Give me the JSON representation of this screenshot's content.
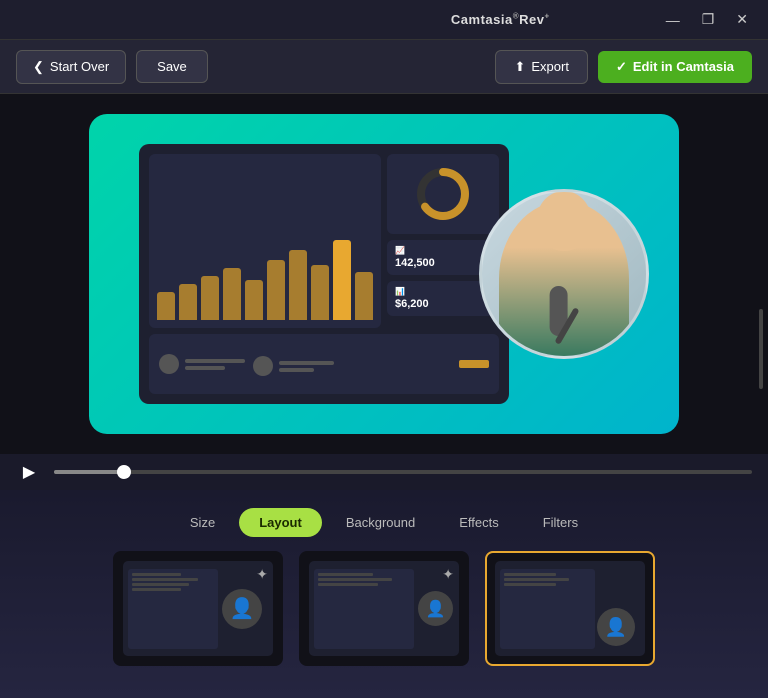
{
  "titleBar": {
    "title": "Camtasia",
    "titleSuffix": "®Rev",
    "titleSuperscript": "+",
    "minBtn": "—",
    "maxBtn": "❐",
    "closeBtn": "✕"
  },
  "toolbar": {
    "startOverLabel": "Start Over",
    "saveLabel": "Save",
    "exportLabel": "Export",
    "editInCamtasiaLabel": "Edit in Camtasia",
    "checkIcon": "✓",
    "uploadIcon": "⬆",
    "chevronLeft": "❮"
  },
  "preview": {
    "stats": {
      "stat1Label": "142,500",
      "stat2Label": "$6,200"
    }
  },
  "timeline": {
    "progressPercent": 10
  },
  "bottomPanel": {
    "tabs": [
      {
        "id": "size",
        "label": "Size",
        "active": false
      },
      {
        "id": "layout",
        "label": "Layout",
        "active": true
      },
      {
        "id": "background",
        "label": "Background",
        "active": false
      },
      {
        "id": "effects",
        "label": "Effects",
        "active": false
      },
      {
        "id": "filters",
        "label": "Filters",
        "active": false
      }
    ],
    "layouts": [
      {
        "id": "layout1",
        "selected": false,
        "sparkle": true
      },
      {
        "id": "layout2",
        "selected": false,
        "sparkle": true
      },
      {
        "id": "layout3",
        "selected": true,
        "sparkle": false
      }
    ]
  }
}
